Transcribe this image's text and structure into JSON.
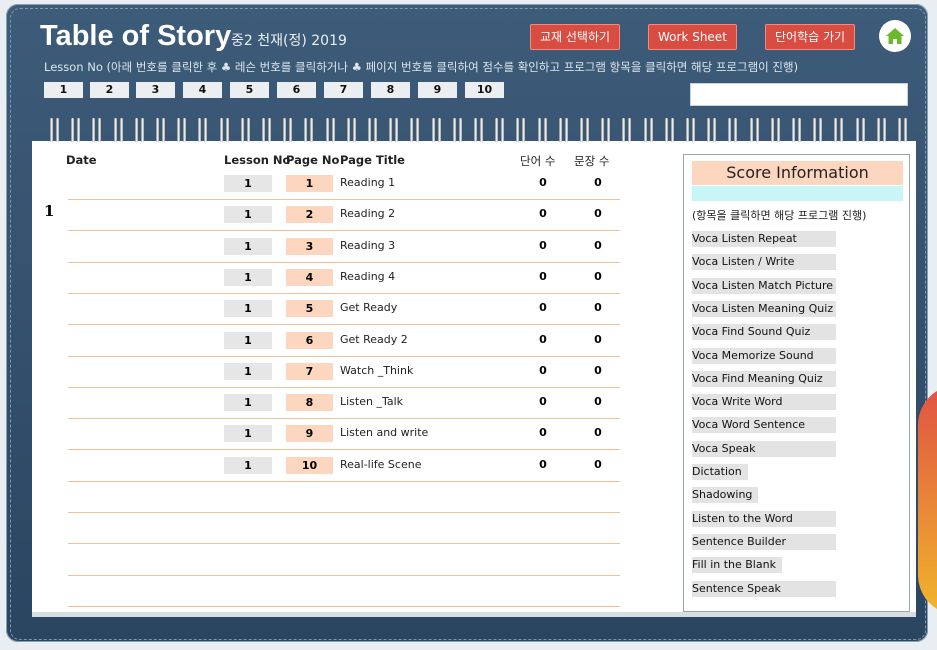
{
  "header": {
    "title": "Table of Story",
    "subtitle": "중2 천재(정) 2019",
    "buttons": [
      "교재 선택하기",
      "Work Sheet",
      "단어학습 가기"
    ],
    "instruction": "Lesson No (아래 번호를 클릭한 후 ♣ 레슨 번호를 클릭하거나 ♣ 페이지 번호를 클릭하여 점수를 확인하고 프로그램 항목을 클릭하면 해당 프로그램이 진행)",
    "lesson_numbers": [
      "1",
      "2",
      "3",
      "4",
      "5",
      "6",
      "7",
      "8",
      "9",
      "10"
    ],
    "search_value": ""
  },
  "table": {
    "headers": {
      "date": "Date",
      "lesson_no": "Lesson No",
      "page_no": "Page No",
      "page_title": "Page Title",
      "word_count": "단어 수",
      "sentence_count": "문장 수"
    },
    "lesson_label": "1",
    "rows": [
      {
        "lesson": "1",
        "page": "1",
        "title": "Reading 1",
        "words": "0",
        "sentences": "0"
      },
      {
        "lesson": "1",
        "page": "2",
        "title": "Reading 2",
        "words": "0",
        "sentences": "0"
      },
      {
        "lesson": "1",
        "page": "3",
        "title": "Reading 3",
        "words": "0",
        "sentences": "0"
      },
      {
        "lesson": "1",
        "page": "4",
        "title": "Reading 4",
        "words": "0",
        "sentences": "0"
      },
      {
        "lesson": "1",
        "page": "5",
        "title": "Get Ready",
        "words": "0",
        "sentences": "0"
      },
      {
        "lesson": "1",
        "page": "6",
        "title": "Get Ready 2",
        "words": "0",
        "sentences": "0"
      },
      {
        "lesson": "1",
        "page": "7",
        "title": "Watch _Think",
        "words": "0",
        "sentences": "0"
      },
      {
        "lesson": "1",
        "page": "8",
        "title": "Listen _Talk",
        "words": "0",
        "sentences": "0"
      },
      {
        "lesson": "1",
        "page": "9",
        "title": "Listen and write",
        "words": "0",
        "sentences": "0"
      },
      {
        "lesson": "1",
        "page": "10",
        "title": "Real-life Scene",
        "words": "0",
        "sentences": "0"
      }
    ]
  },
  "score_panel": {
    "title": "Score Information",
    "note": "(항목을 클릭하면 해당 프로그램 진행)",
    "items": [
      "Voca Listen Repeat",
      "Voca Listen / Write",
      "Voca Listen Match Picture",
      "Voca Listen Meaning Quiz",
      "Voca Find Sound Quiz",
      "Voca Memorize Sound",
      "Voca Find Meaning Quiz",
      "Voca Write Word",
      "Voca Word Sentence",
      "Voca Speak",
      "Dictation",
      "Shadowing",
      "Listen to the Word",
      "Sentence Builder",
      "Fill in the Blank",
      "Sentence Speak"
    ]
  },
  "colors": {
    "frame": "#2f4c68",
    "button_red": "#d94c42",
    "page_cell": "#fcd6bf",
    "lesson_cell": "#e6e6e6",
    "row_line": "#f1c29a",
    "score_title_bar": "#c8f6f7",
    "home_icon": "#6ab82b"
  },
  "icons": {
    "home": "home-icon"
  }
}
